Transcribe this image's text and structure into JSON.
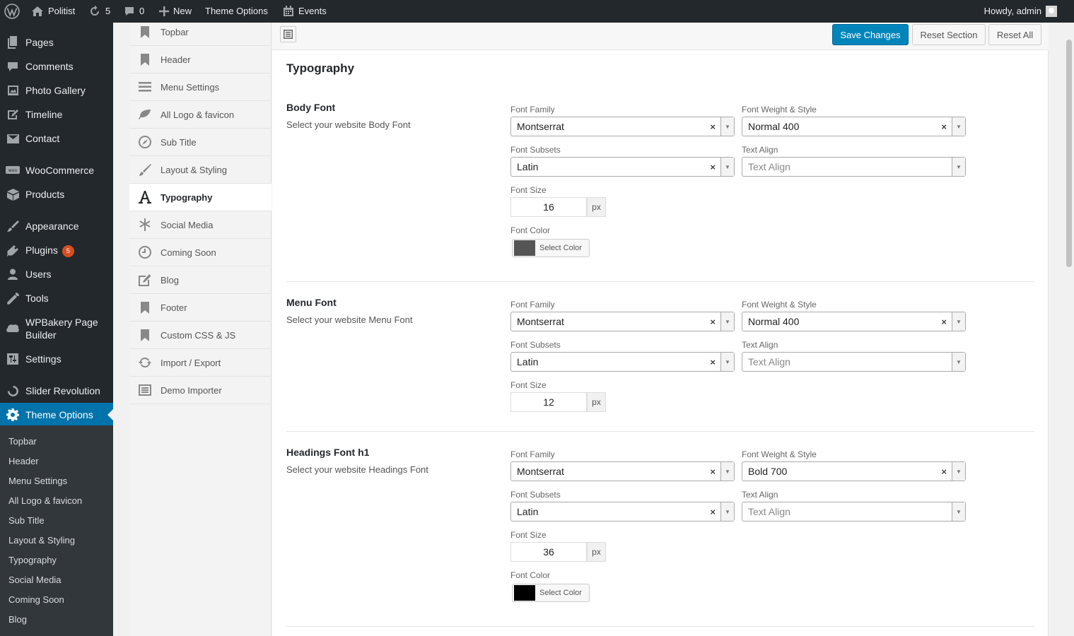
{
  "admin_bar": {
    "site_name": "Politist",
    "updates_count": "5",
    "comments_count": "0",
    "new_label": "New",
    "theme_options_label": "Theme Options",
    "events_label": "Events",
    "howdy": "Howdy, admin"
  },
  "admin_menu": {
    "items": [
      {
        "label": "Pages",
        "icon": "pages-icon"
      },
      {
        "label": "Comments",
        "icon": "comments-icon"
      },
      {
        "label": "Photo Gallery",
        "icon": "gallery-icon"
      },
      {
        "label": "Timeline",
        "icon": "timeline-icon"
      },
      {
        "label": "Contact",
        "icon": "mail-icon"
      },
      {
        "label": "WooCommerce",
        "icon": "woocommerce-icon"
      },
      {
        "label": "Products",
        "icon": "products-icon"
      },
      {
        "label": "Appearance",
        "icon": "appearance-icon"
      },
      {
        "label": "Plugins",
        "icon": "plugins-icon"
      },
      {
        "label": "Users",
        "icon": "users-icon"
      },
      {
        "label": "Tools",
        "icon": "tools-icon"
      },
      {
        "label": "WPBakery Page Builder",
        "icon": "wpbakery-icon"
      },
      {
        "label": "Settings",
        "icon": "settings-icon"
      },
      {
        "label": "Slider Revolution",
        "icon": "slider-icon"
      },
      {
        "label": "Theme Options",
        "icon": "gear-icon"
      }
    ],
    "plugins_badge": "5",
    "submenu": [
      "Topbar",
      "Header",
      "Menu Settings",
      "All Logo & favicon",
      "Sub Title",
      "Layout & Styling",
      "Typography",
      "Social Media",
      "Coming Soon",
      "Blog"
    ]
  },
  "options_sidebar": {
    "items": [
      {
        "label": "Topbar",
        "icon": "bookmark-icon"
      },
      {
        "label": "Header",
        "icon": "bookmark-icon"
      },
      {
        "label": "Menu Settings",
        "icon": "menu-icon"
      },
      {
        "label": "All Logo & favicon",
        "icon": "leaf-icon"
      },
      {
        "label": "Sub Title",
        "icon": "compass-icon"
      },
      {
        "label": "Layout & Styling",
        "icon": "brush-icon"
      },
      {
        "label": "Typography",
        "icon": "typography-icon"
      },
      {
        "label": "Social Media",
        "icon": "star-icon"
      },
      {
        "label": "Coming Soon",
        "icon": "clock-icon"
      },
      {
        "label": "Blog",
        "icon": "edit-icon"
      },
      {
        "label": "Footer",
        "icon": "bookmark-icon"
      },
      {
        "label": "Custom CSS & JS",
        "icon": "bookmark-icon"
      },
      {
        "label": "Import / Export",
        "icon": "refresh-icon"
      },
      {
        "label": "Demo Importer",
        "icon": "importer-icon"
      }
    ],
    "active": "Typography"
  },
  "toolbar": {
    "save_label": "Save Changes",
    "reset_section_label": "Reset Section",
    "reset_all_label": "Reset All"
  },
  "section_title": "Typography",
  "labels": {
    "font_family": "Font Family",
    "font_weight_style": "Font Weight & Style",
    "font_subsets": "Font Subsets",
    "text_align": "Text Align",
    "font_size": "Font Size",
    "font_color": "Font Color",
    "px": "px",
    "select_color": "Select Color"
  },
  "groups": [
    {
      "title": "Body Font",
      "description": "Select your website Body Font",
      "font_family": "Montserrat",
      "font_weight": "Normal 400",
      "font_subsets": "Latin",
      "text_align_placeholder": "Text Align",
      "font_size": "16",
      "color": "#555555"
    },
    {
      "title": "Menu Font",
      "description": "Select your website Menu Font",
      "font_family": "Montserrat",
      "font_weight": "Normal 400",
      "font_subsets": "Latin",
      "text_align_placeholder": "Text Align",
      "font_size": "12"
    },
    {
      "title": "Headings Font h1",
      "description": "Select your website Headings Font",
      "font_family": "Montserrat",
      "font_weight": "Bold 700",
      "font_subsets": "Latin",
      "text_align_placeholder": "Text Align",
      "font_size": "36",
      "color": "#000000"
    }
  ],
  "colors": {
    "admin_bar_bg": "#23282d",
    "accent": "#0073aa",
    "primary_button": "#0085ba",
    "badge": "#d54e21"
  }
}
